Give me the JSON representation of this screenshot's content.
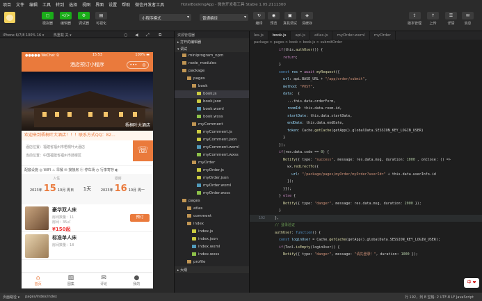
{
  "menu": [
    "项目",
    "文件",
    "编辑",
    "工具",
    "转到",
    "选择",
    "视图",
    "界面",
    "设置",
    "帮助",
    "微信开发者工具"
  ],
  "window_title": "HotelBookingApp - 微信开发者工具 Stable 1.05.2111300",
  "toolbar": {
    "buttons": [
      {
        "icon": "▢",
        "label": "模拟器"
      },
      {
        "icon": "</>",
        "label": "编辑器"
      },
      {
        "icon": "⚙",
        "label": "调试器"
      },
      {
        "icon": "▤",
        "label": "可视化"
      }
    ],
    "mode_select": "小程序模式",
    "compile_select": "普通编译",
    "right_buttons": [
      {
        "icon": "↻",
        "label": "编译"
      },
      {
        "icon": "◉",
        "label": "预览"
      },
      {
        "icon": "▣",
        "label": "真机调试"
      },
      {
        "icon": "◈",
        "label": "清缓存"
      },
      {
        "icon": "⇪",
        "label": "版本管理"
      },
      {
        "icon": "↑",
        "label": "上传"
      },
      {
        "icon": "☰",
        "label": "详情"
      },
      {
        "icon": "✉",
        "label": "消息"
      }
    ]
  },
  "simulator_bar": {
    "device": "iPhone 6/7/8 100% 16 ▾",
    "hot_reload": "热重载 关 ▾"
  },
  "phone": {
    "carrier": "●●●●● WeChat 令",
    "time": "15:53",
    "battery": "100% ▬",
    "nav_title": "酒店预订小程序",
    "capsule": [
      "•••",
      "◎"
    ],
    "hero_caption": "梧桐叶大酒店",
    "marquee": "欢迎来到梧桐叶大酒店！！！联系方式QQ：82...",
    "address_1": "酒店位置：福建省福州市梧桐叶大酒店",
    "address_2": "当前位置：中国福建省福州市鼓楼区",
    "call_icon": "☏",
    "facilities": "配套设施   ◎ WIFI   ♨ 早餐   ✉ 接接房   ⓟ 停车场   ◷ 行李寄存   ◐",
    "checkin_label": "入住",
    "checkout_label": "退房",
    "checkin_year": "2023年",
    "checkin_day": "15",
    "checkin_month": "10月",
    "checkin_week": "周日",
    "nights": "1天",
    "checkout_year": "2023年",
    "checkout_day": "16",
    "checkout_month": "10月",
    "checkout_week": "周一",
    "rooms": [
      {
        "name": "豪华双人床",
        "remain": "房间数量：11",
        "size": "房间：35㎡",
        "price": "¥150起",
        "book": "预订"
      },
      {
        "name": "标准单人床",
        "remain": "房间数量：18",
        "size": "",
        "price": "",
        "book": "预订"
      }
    ],
    "tabs": [
      {
        "icon": "⌂",
        "label": "首页"
      },
      {
        "icon": "▨",
        "label": "图集"
      },
      {
        "icon": "✉",
        "label": "评论"
      },
      {
        "icon": "●",
        "label": "我的"
      }
    ]
  },
  "explorer": {
    "header": "资源管理器",
    "open_editors": "▸ 打开的编辑器",
    "project": "▾ 调试",
    "items": [
      {
        "indent": 1,
        "type": "folder",
        "name": "miniprogram_npm"
      },
      {
        "indent": 1,
        "type": "folder",
        "name": "node_modules"
      },
      {
        "indent": 1,
        "type": "folder",
        "name": "package"
      },
      {
        "indent": 2,
        "type": "folder",
        "name": "pages"
      },
      {
        "indent": 3,
        "type": "folder",
        "name": "book"
      },
      {
        "indent": 4,
        "type": "js",
        "name": "book.js"
      },
      {
        "indent": 4,
        "type": "json",
        "name": "book.json"
      },
      {
        "indent": 4,
        "type": "wxml",
        "name": "book.wxml"
      },
      {
        "indent": 4,
        "type": "wxss",
        "name": "book.wxss"
      },
      {
        "indent": 3,
        "type": "folder",
        "name": "myComment"
      },
      {
        "indent": 4,
        "type": "js",
        "name": "myComment.js"
      },
      {
        "indent": 4,
        "type": "json",
        "name": "myComment.json"
      },
      {
        "indent": 4,
        "type": "wxml",
        "name": "myComment.wxml"
      },
      {
        "indent": 4,
        "type": "wxss",
        "name": "myComment.wxss"
      },
      {
        "indent": 3,
        "type": "folder",
        "name": "myOrder"
      },
      {
        "indent": 4,
        "type": "js",
        "name": "myOrder.js"
      },
      {
        "indent": 4,
        "type": "json",
        "name": "myOrder.json"
      },
      {
        "indent": 4,
        "type": "wxml",
        "name": "myOrder.wxml"
      },
      {
        "indent": 4,
        "type": "wxss",
        "name": "myOrder.wxss"
      },
      {
        "indent": 1,
        "type": "folder",
        "name": "pages"
      },
      {
        "indent": 2,
        "type": "folder",
        "name": "atlas"
      },
      {
        "indent": 2,
        "type": "folder",
        "name": "comment"
      },
      {
        "indent": 2,
        "type": "folder",
        "name": "index"
      },
      {
        "indent": 3,
        "type": "js",
        "name": "index.js"
      },
      {
        "indent": 3,
        "type": "json",
        "name": "index.json"
      },
      {
        "indent": 3,
        "type": "wxml",
        "name": "index.wxml"
      },
      {
        "indent": 3,
        "type": "wxss",
        "name": "index.wxss"
      },
      {
        "indent": 2,
        "type": "folder",
        "name": "profile"
      }
    ],
    "outline": "▸ 大纲"
  },
  "editor": {
    "tabs": [
      "les.js",
      "book.js",
      "api.js",
      "atlas.js",
      "myOrder.wxml",
      "myOrder"
    ],
    "active_tab": "book.js",
    "breadcrumb": "package > pages > book > book.js > submitOrder",
    "lines": [
      {
        "no": "",
        "tokens": [
          [
            "k",
            "    if"
          ],
          [
            "p",
            "(this."
          ],
          [
            "f",
            "authUser"
          ],
          [
            "p",
            "()) {"
          ]
        ]
      },
      {
        "no": "",
        "tokens": [
          [
            "k",
            "      return"
          ],
          [
            "p",
            ";"
          ]
        ]
      },
      {
        "no": "",
        "tokens": [
          [
            "p",
            "    }"
          ]
        ]
      },
      {
        "no": "",
        "tokens": [
          [
            "b",
            "    const "
          ],
          [
            "v",
            "res"
          ],
          [
            "p",
            " = "
          ],
          [
            "k",
            "await "
          ],
          [
            "f",
            "myRequest"
          ],
          [
            "p",
            "({"
          ]
        ]
      },
      {
        "no": "",
        "tokens": [
          [
            "v",
            "      url"
          ],
          [
            "p",
            ": api.BASE_URL + "
          ],
          [
            "s",
            "\"/app/order/submit\""
          ],
          [
            "p",
            ","
          ]
        ]
      },
      {
        "no": "",
        "tokens": [
          [
            "v",
            "      method"
          ],
          [
            "p",
            ": "
          ],
          [
            "s",
            "\"POST\""
          ],
          [
            "p",
            ","
          ]
        ]
      },
      {
        "no": "",
        "tokens": [
          [
            "v",
            "      data"
          ],
          [
            "p",
            ":  {"
          ]
        ]
      },
      {
        "no": "",
        "tokens": [
          [
            "p",
            "        ...this.data.orderForm,"
          ]
        ]
      },
      {
        "no": "",
        "tokens": [
          [
            "v",
            "        roomId"
          ],
          [
            "p",
            ": this.data.room.id,"
          ]
        ]
      },
      {
        "no": "",
        "tokens": [
          [
            "v",
            "        startDate"
          ],
          [
            "p",
            ": this.data.startDate,"
          ]
        ]
      },
      {
        "no": "",
        "tokens": [
          [
            "v",
            "        endDate"
          ],
          [
            "p",
            ": this.data.endDate,"
          ]
        ]
      },
      {
        "no": "",
        "tokens": [
          [
            "v",
            "        token"
          ],
          [
            "p",
            ": Cache."
          ],
          [
            "f",
            "getCache"
          ],
          [
            "p",
            "(getApp().globalData.SESSION_KEY_LOGIN_USER)"
          ]
        ]
      },
      {
        "no": "",
        "tokens": [
          [
            "p",
            "      }"
          ]
        ]
      },
      {
        "no": "",
        "tokens": [
          [
            "p",
            "    });"
          ]
        ]
      },
      {
        "no": "",
        "tokens": [
          [
            "k",
            "    if"
          ],
          [
            "p",
            "(res.data.code == "
          ],
          [
            "n",
            "0"
          ],
          [
            "p",
            ") {"
          ]
        ]
      },
      {
        "no": "",
        "tokens": [
          [
            "f",
            "      Notify"
          ],
          [
            "p",
            "({ type: "
          ],
          [
            "s",
            "\"success\""
          ],
          [
            "p",
            ", message: res.data.msg, duration: "
          ],
          [
            "n",
            "1000"
          ],
          [
            "p",
            " , onClose: () =>"
          ]
        ]
      },
      {
        "no": "",
        "tokens": [
          [
            "p",
            "        wx."
          ],
          [
            "f",
            "redirectTo"
          ],
          [
            "p",
            "({"
          ]
        ]
      },
      {
        "no": "",
        "tokens": [
          [
            "v",
            "          url"
          ],
          [
            "p",
            ": "
          ],
          [
            "s",
            "\"/package/pages/myOrder/myOrder?userId=\""
          ],
          [
            "p",
            " + this.data.userInfo.id"
          ]
        ]
      },
      {
        "no": "",
        "tokens": [
          [
            "p",
            "        });"
          ]
        ]
      },
      {
        "no": "",
        "tokens": [
          [
            "p",
            "      }});"
          ]
        ]
      },
      {
        "no": "",
        "tokens": [
          [
            "p",
            "    } "
          ],
          [
            "k",
            "else"
          ],
          [
            "p",
            " {"
          ]
        ]
      },
      {
        "no": "",
        "tokens": [
          [
            "f",
            "      Notify"
          ],
          [
            "p",
            "({ type: "
          ],
          [
            "s",
            "\"danger\""
          ],
          [
            "p",
            ", message: res.data.msg, duration: "
          ],
          [
            "n",
            "2000"
          ],
          [
            "p",
            " });"
          ]
        ]
      },
      {
        "no": "",
        "tokens": [
          [
            "p",
            "    }"
          ]
        ]
      },
      {
        "no": "192",
        "cur": true,
        "tokens": [
          [
            "p",
            "  },"
          ]
        ]
      },
      {
        "no": "",
        "tokens": [
          [
            "c",
            "  // 登录验证"
          ]
        ]
      },
      {
        "no": "",
        "tokens": [
          [
            "f",
            "  authUser"
          ],
          [
            "p",
            ": "
          ],
          [
            "b",
            "function"
          ],
          [
            "p",
            "() {"
          ]
        ]
      },
      {
        "no": "",
        "tokens": [
          [
            "b",
            "    const "
          ],
          [
            "v",
            "loginUser"
          ],
          [
            "p",
            " = Cache."
          ],
          [
            "f",
            "getCache"
          ],
          [
            "p",
            "(getApp().globalData.SESSION_KEY_LOGIN_USER);"
          ]
        ]
      },
      {
        "no": "",
        "tokens": [
          [
            "k",
            "    if"
          ],
          [
            "p",
            "(Tool."
          ],
          [
            "f",
            "isEmpty"
          ],
          [
            "p",
            "(loginUser)) {"
          ]
        ]
      },
      {
        "no": "",
        "tokens": [
          [
            "f",
            "      Notify"
          ],
          [
            "p",
            "({ type: "
          ],
          [
            "s",
            "\"danger\""
          ],
          [
            "p",
            ", message: "
          ],
          [
            "s",
            "\"请先登录！\""
          ],
          [
            "p",
            ", duration: "
          ],
          [
            "n",
            "1000"
          ],
          [
            "p",
            " });"
          ]
        ]
      }
    ]
  },
  "statusbar": {
    "left": "页面路径 ▾",
    "path": "pages/index/index",
    "right": "行 192，列 8  空格: 2  UTF-8  LF  JavaScript"
  },
  "floating_widget": "中 ❤"
}
